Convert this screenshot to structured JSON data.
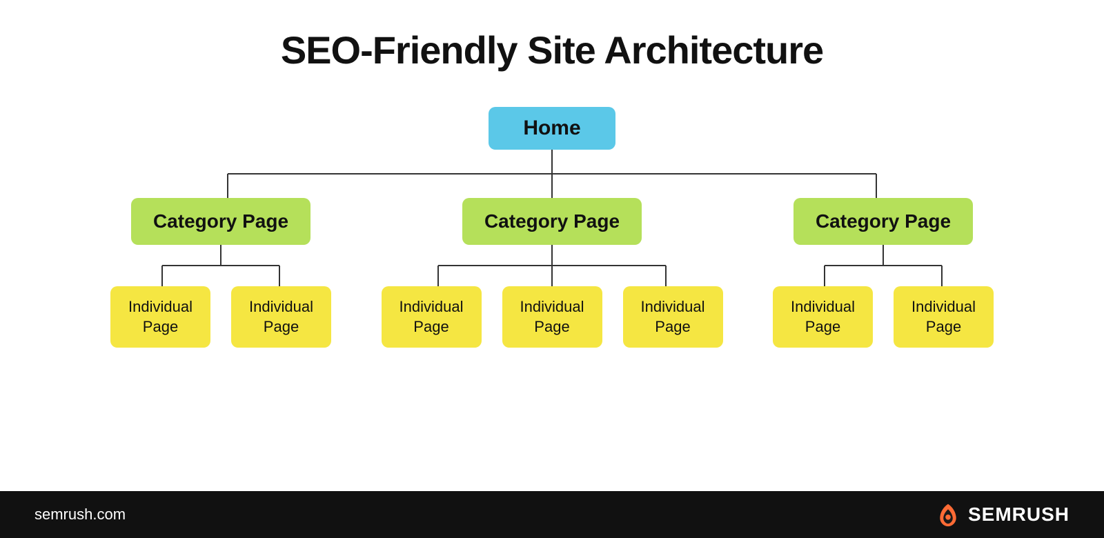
{
  "header": {
    "title": "SEO-Friendly Site Architecture"
  },
  "tree": {
    "home": {
      "label": "Home"
    },
    "categories": [
      {
        "label": "Category Page",
        "children": [
          {
            "label": "Individual\nPage"
          },
          {
            "label": "Individual\nPage"
          }
        ]
      },
      {
        "label": "Category Page",
        "children": [
          {
            "label": "Individual\nPage"
          },
          {
            "label": "Individual\nPage"
          },
          {
            "label": "Individual\nPage"
          }
        ]
      },
      {
        "label": "Category Page",
        "children": [
          {
            "label": "Individual\nPage"
          },
          {
            "label": "Individual\nPage"
          }
        ]
      }
    ]
  },
  "footer": {
    "url": "semrush.com",
    "brand": "SEMRUSH"
  },
  "colors": {
    "home_bg": "#5bc8e8",
    "category_bg": "#b5e05a",
    "individual_bg": "#f5e642",
    "footer_bg": "#111111",
    "semrush_orange": "#ff6b35"
  }
}
